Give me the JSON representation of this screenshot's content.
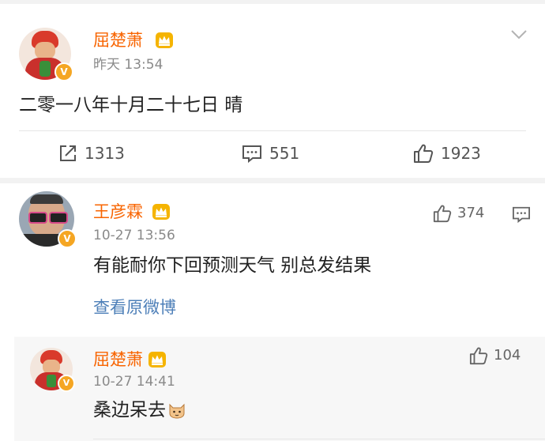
{
  "post": {
    "author": "屈楚萧",
    "time": "昨天 13:54",
    "text": "二零一八年十月二十七日 晴",
    "repost_count": "1313",
    "comment_count": "551",
    "like_count": "1923",
    "menu_icon": "chevron-down-icon"
  },
  "comment": {
    "author": "王彦霖",
    "time": "10-27 13:56",
    "text": "有能耐你下回预测天气 别总发结果",
    "like_count": "374",
    "view_original": "查看原微博"
  },
  "reply": {
    "author": "屈楚萧",
    "time": "10-27 14:41",
    "text": "桑边呆去",
    "like_count": "104"
  },
  "badge_letter": "V",
  "colors": {
    "username": "#f86400",
    "link": "#4d7fb8",
    "badge": "#f5a623",
    "crown": "#f5b400"
  }
}
